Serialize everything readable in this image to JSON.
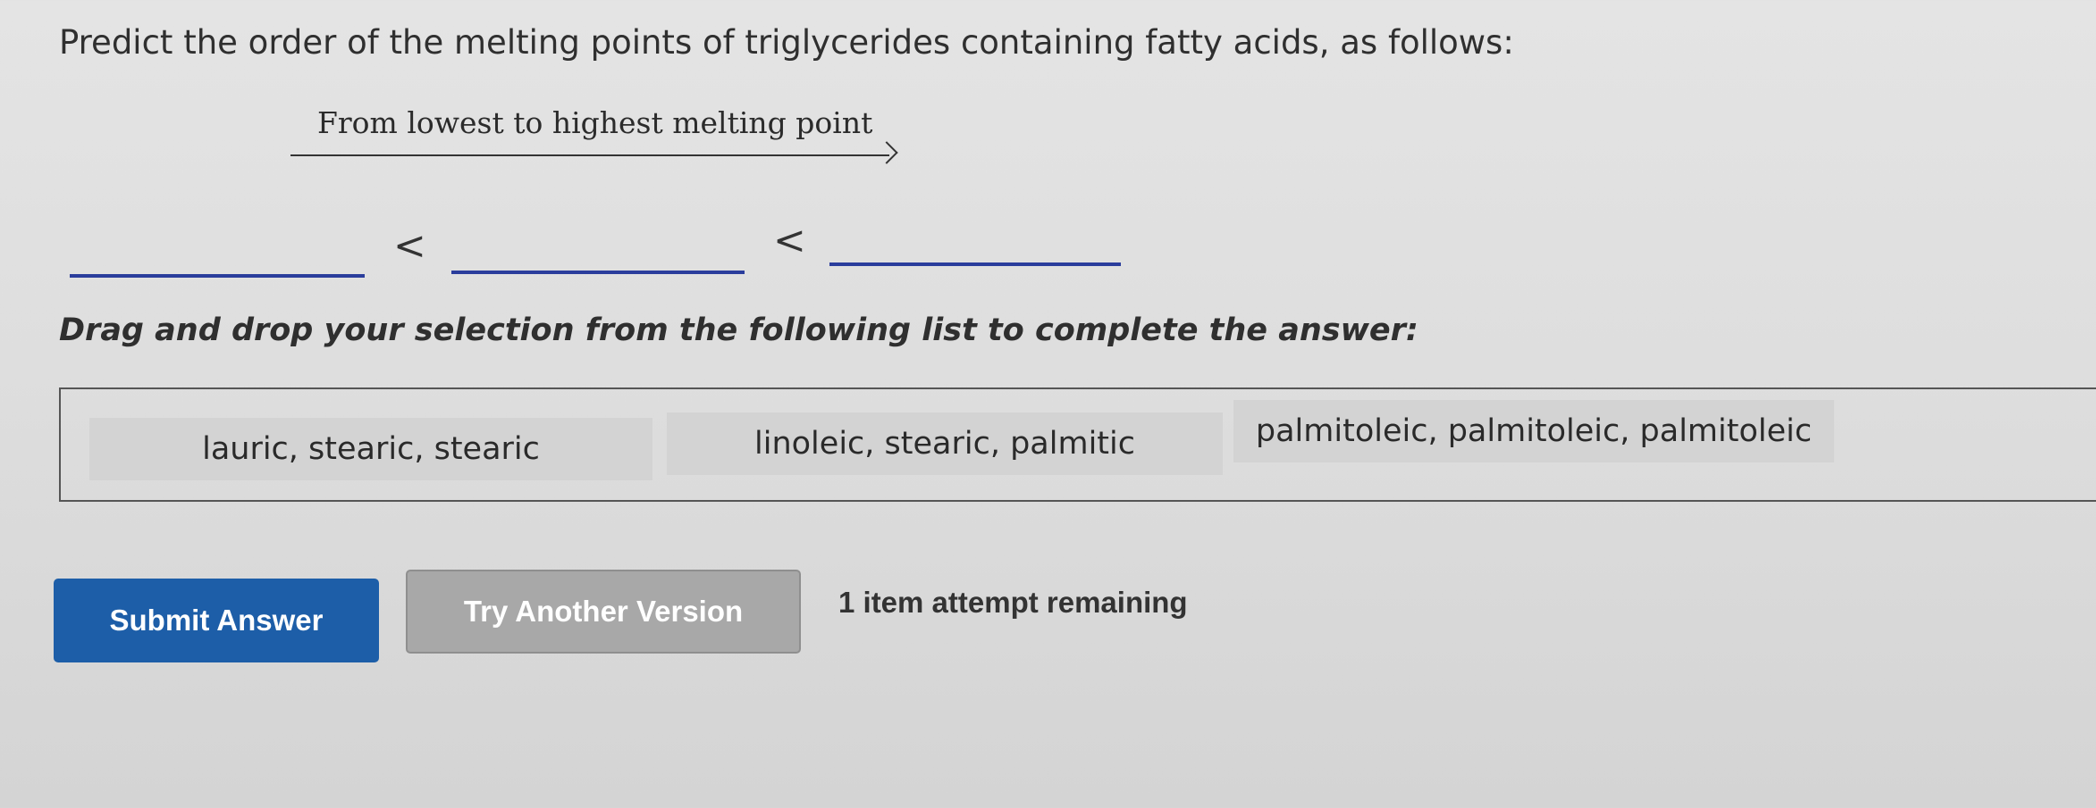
{
  "question": {
    "text": "Predict the order of the melting points of triglycerides containing fatty acids, as follows:"
  },
  "ordering": {
    "arrow_label": "From lowest to highest melting point",
    "separator": "<"
  },
  "instruction": {
    "text": "Drag and drop your selection from the following list to complete the answer:"
  },
  "choices": [
    {
      "label": "lauric, stearic, stearic"
    },
    {
      "label": "linoleic, stearic, palmitic"
    },
    {
      "label": "palmitoleic, palmitoleic, palmitoleic"
    }
  ],
  "buttons": {
    "submit_label": "Submit Answer",
    "try_another_label": "Try Another Version"
  },
  "status": {
    "attempts_text": "1 item attempt remaining"
  },
  "colors": {
    "blank_line": "#2a3d9c",
    "submit_button": "#1d5ea8",
    "try_button": "#a8a8a8"
  }
}
